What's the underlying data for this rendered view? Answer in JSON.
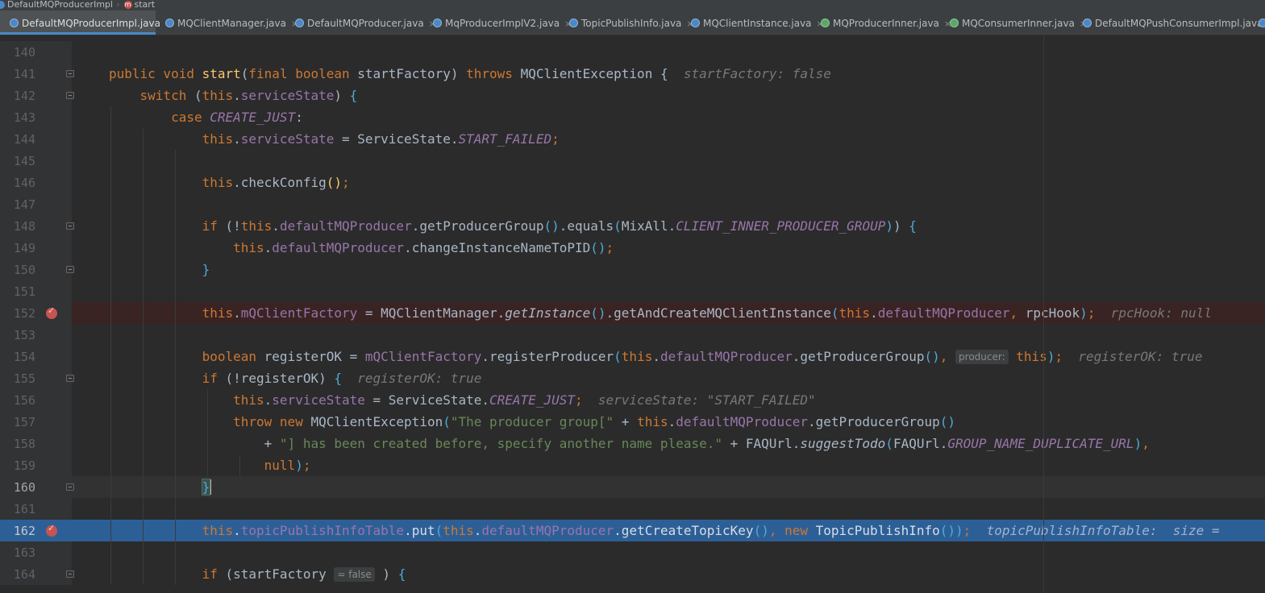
{
  "breadcrumb": {
    "class_name": "DefaultMQProducerImpl",
    "method_icon": "m",
    "method_name": "start"
  },
  "tabs": [
    {
      "label": "DefaultMQProducerImpl.java",
      "icon": "class-icon",
      "active": true
    },
    {
      "label": "MQClientManager.java",
      "icon": "class-icon"
    },
    {
      "label": "DefaultMQProducer.java",
      "icon": "class-icon"
    },
    {
      "label": "MqProducerImplV2.java",
      "icon": "class-icon"
    },
    {
      "label": "TopicPublishInfo.java",
      "icon": "class-icon"
    },
    {
      "label": "MQClientInstance.java",
      "icon": "class-icon"
    },
    {
      "label": "MQProducerInner.java",
      "icon": "interface-icon"
    },
    {
      "label": "MQConsumerInner.java",
      "icon": "interface-icon"
    },
    {
      "label": "DefaultMQPushConsumerImpl.java",
      "icon": "class-icon"
    }
  ],
  "tab_close_glyph": "×",
  "editor": {
    "line_numbers": [
      "140",
      "141",
      "142",
      "143",
      "144",
      "145",
      "146",
      "147",
      "148",
      "149",
      "150",
      "151",
      "152",
      "153",
      "154",
      "155",
      "156",
      "157",
      "158",
      "159",
      "160",
      "161",
      "162",
      "163",
      "164"
    ],
    "breakpoint_lines": [
      "152",
      "162"
    ],
    "execution_line": "162",
    "hints": {
      "l141": "startFactory: false",
      "l152": "rpcHook: null",
      "l154_param": "producer:",
      "l154": "registerOK: true",
      "l155": "registerOK: true",
      "l156": "serviceState: \"START_FAILED\"",
      "l162": "topicPublishInfoTable:  size = ",
      "l164_param": "= false"
    }
  },
  "colors": {
    "background": "#2b2b2b",
    "keyword": "#cc7832",
    "method_decl": "#ffc66d",
    "field": "#9876aa",
    "string": "#6a8759",
    "breakpoint": "#c75450",
    "execution_line": "#2d5f97"
  }
}
